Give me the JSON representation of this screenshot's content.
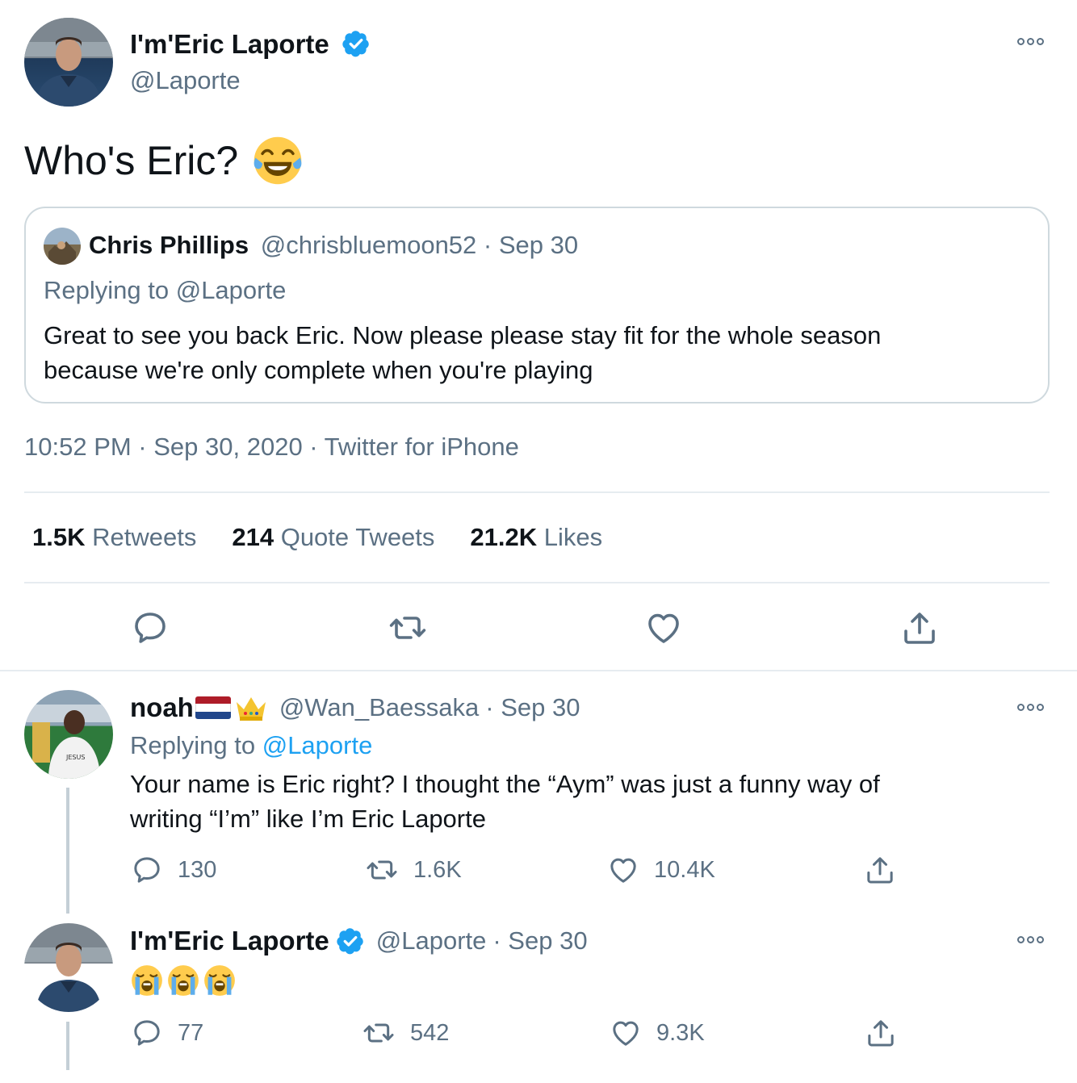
{
  "main_tweet": {
    "display_name": "I'm'Eric Laporte",
    "handle": "@Laporte",
    "text": "Who's Eric?",
    "emoji": "face-with-tears-of-joy",
    "quoted": {
      "display_name": "Chris Phillips",
      "handle": "@chrisbluemoon52",
      "date": "· Sep 30",
      "replying_prefix": "Replying to",
      "replying_handle": "@Laporte",
      "text_line1": "Great to see you back Eric. Now please please stay fit for the whole season",
      "text_line2": "because we're only complete when you're playing"
    },
    "timestamp": "10:52 PM · Sep 30, 2020 · Twitter for iPhone",
    "stats": {
      "retweets_count": "1.5K",
      "retweets_label": "Retweets",
      "quotes_count": "214",
      "quotes_label": "Quote Tweets",
      "likes_count": "21.2K",
      "likes_label": "Likes"
    }
  },
  "reply_1": {
    "display_name": "noah",
    "flag": "netherlands-flag",
    "crown": "crown-emoji",
    "handle": "@Wan_Baessaka",
    "date": "· Sep 30",
    "replying_prefix": "Replying to",
    "replying_handle": "@Laporte",
    "text_line1": "Your name is Eric right? I thought the “Aym” was just a funny way of",
    "text_line2": "writing “I’m” like I’m Eric Laporte",
    "replies": "130",
    "retweets": "1.6K",
    "likes": "10.4K"
  },
  "reply_2": {
    "display_name": "I'm'Eric Laporte",
    "handle": "@Laporte",
    "date": "· Sep 30",
    "emoji": "loudly-crying-face x3",
    "replies": "77",
    "retweets": "542",
    "likes": "9.3K"
  },
  "colors": {
    "text": "#0f1419",
    "secondary": "#5b7083",
    "accent": "#1da1f2",
    "border": "#cfd9de",
    "divider": "#e6ecf0"
  },
  "icons": [
    "reply-icon",
    "retweet-icon",
    "like-icon",
    "share-icon",
    "more-icon",
    "verified-badge-icon"
  ]
}
